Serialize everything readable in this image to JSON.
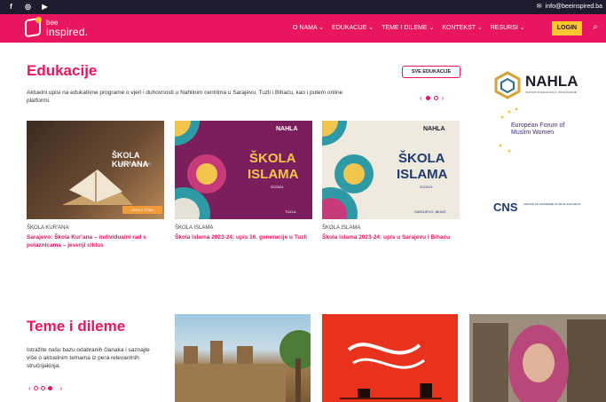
{
  "topbar": {
    "social": [
      "facebook-icon",
      "instagram-icon",
      "youtube-icon"
    ],
    "email": "info@beeinspired.ba"
  },
  "header": {
    "logo_top": "bee",
    "logo_bottom": "inspired.",
    "nav": [
      {
        "label": "O NAMA ⌄"
      },
      {
        "label": "EDUKACIJE ⌄"
      },
      {
        "label": "TEME I DILEME ⌄"
      },
      {
        "label": "KONTEKST ⌄"
      },
      {
        "label": "RESURSI ⌄"
      }
    ],
    "login": "LOGIN"
  },
  "edukacije": {
    "title": "Edukacije",
    "description": "Aktuelni upisi na edukativne programe o vjeri i duhovnosti u Nahlinim centrima u Sarajevu, Tuzli i Bihaću, kao i putem online platformi.",
    "button": "SVE EDUKACIJE",
    "prev": "‹",
    "next": "›",
    "cards": [
      {
        "category": "ŠKOLA KUR'ANA",
        "title": "Sarajevo: Škola Kur'ana – individualni rad s polaznicama – jesenji ciklus",
        "img_title": "ŠKOLA KUR'ANA",
        "img_sub": "INDIVIDUALNI RAD",
        "img_btn": "UPIS U TOKU"
      },
      {
        "category": "ŠKOLA ISLAMA",
        "title": "Škola islama 2023-24: upis 16. generacije u Tuzli",
        "img_brand": "NAHLA",
        "img_title1": "ŠKOLA",
        "img_title2": "ISLAMA",
        "img_year": "2023/24",
        "img_city": "TUZLA"
      },
      {
        "category": "ŠKOLA ISLAMA",
        "title": "Škola islama 2023-24: upis u Sarajevu i Bihaću",
        "img_brand": "NAHLA",
        "img_title1": "ŠKOLA",
        "img_title2": "ISLAMA",
        "img_year": "2023/24",
        "img_city": "SARAJEVO, BIHAĆ"
      }
    ]
  },
  "partners": {
    "nahla": "NAHLA",
    "nahla_sub": "CENTAR ZA EDUKACIJU I ISTRAŽIVANJE",
    "effmw": "European Forum of Muslim Women",
    "cns": "CNS",
    "cns_sub": "CENTAR ZA NAPREDNE STUDIJE SARAJEVO"
  },
  "teme": {
    "title": "Teme i dileme",
    "description": "Istražite našu bazu odabranih članaka i saznajte više o aktuelnim temama iz pera relevantnih stručnjakinja.",
    "prev": "‹",
    "next": "›"
  },
  "colors": {
    "accent": "#e8165e",
    "dark": "#1f1b2e",
    "yellow": "#f9c531"
  }
}
